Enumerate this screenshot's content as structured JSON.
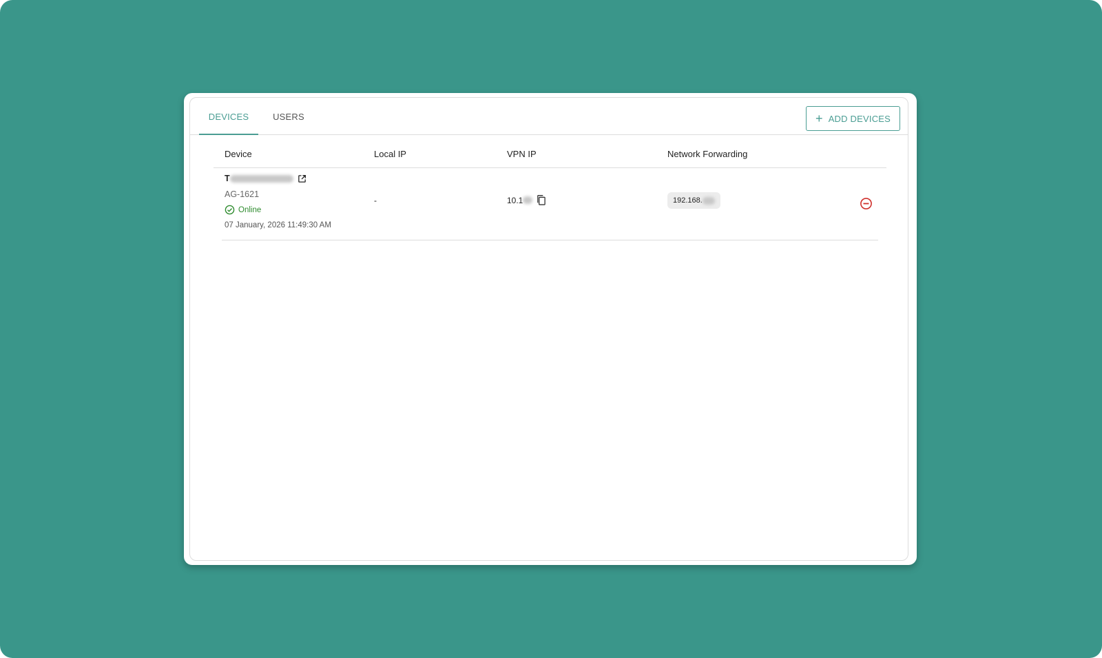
{
  "colors": {
    "background": "#3a968a",
    "accent": "#4a9d93",
    "online": "#2e8b2e",
    "danger": "#d0312d"
  },
  "tabs": [
    {
      "label": "DEVICES",
      "active": true
    },
    {
      "label": "USERS",
      "active": false
    }
  ],
  "toolbar": {
    "add_devices_label": "ADD DEVICES"
  },
  "table": {
    "columns": [
      "Device",
      "Local IP",
      "VPN IP",
      "Network Forwarding"
    ],
    "rows": [
      {
        "device_name_visible": "T",
        "model": "AG-1621",
        "status": "Online",
        "timestamp": "07 January, 2026 11:49:30 AM",
        "local_ip": "-",
        "vpn_ip_visible": "10.1",
        "network_forwarding_visible": "192.168."
      }
    ]
  }
}
